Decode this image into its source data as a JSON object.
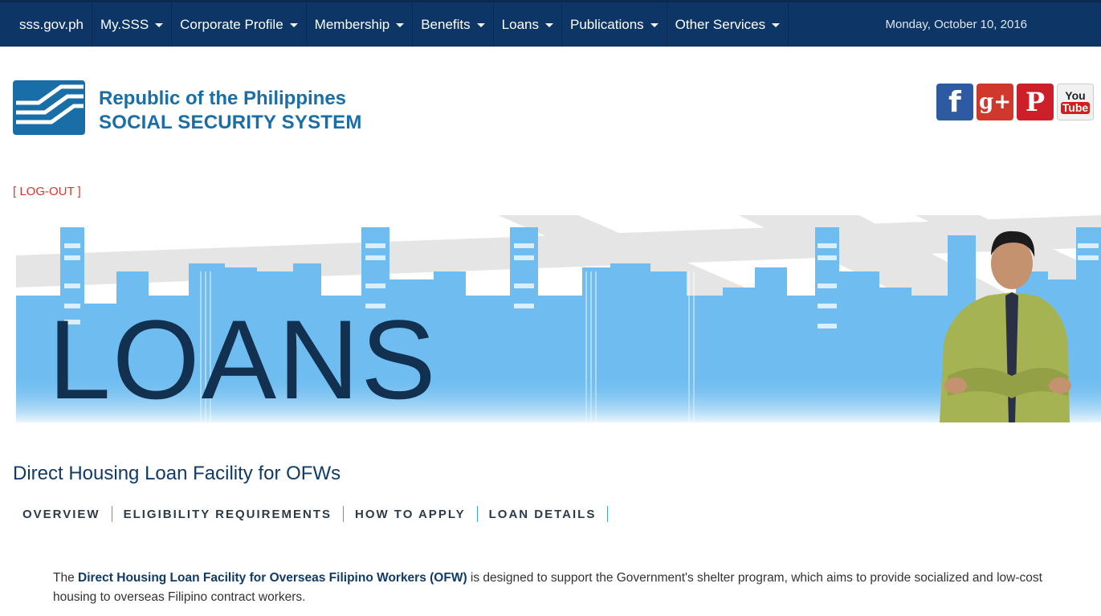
{
  "nav": {
    "home": "sss.gov.ph",
    "items": [
      {
        "label": "My.SSS"
      },
      {
        "label": "Corporate Profile"
      },
      {
        "label": "Membership"
      },
      {
        "label": "Benefits"
      },
      {
        "label": "Loans"
      },
      {
        "label": "Publications"
      },
      {
        "label": "Other Services"
      }
    ],
    "date": "Monday, October 10, 2016"
  },
  "brand": {
    "line1": "Republic of the Philippines",
    "line2": "SOCIAL SECURITY SYSTEM"
  },
  "social": {
    "facebook": "f",
    "googleplus": "g+",
    "pinterest": "P",
    "youtube_top": "You",
    "youtube_bottom": "Tube"
  },
  "logout": "[ LOG-OUT ]",
  "banner": {
    "title": "LOANS"
  },
  "page_title": "Direct Housing Loan Facility for OFWs",
  "subnav": [
    {
      "label": "OVERVIEW"
    },
    {
      "label": "ELIGIBILITY REQUIREMENTS"
    },
    {
      "label": "HOW TO APPLY"
    },
    {
      "label": "LOAN DETAILS"
    }
  ],
  "intro": {
    "prefix": "The ",
    "emphasis": "Direct Housing Loan Facility for Overseas Filipino Workers (OFW)",
    "suffix": " is designed to support the Government's shelter program, which aims to provide socialized and low-cost housing to overseas Filipino contract workers."
  },
  "colors": {
    "nav_bg": "#0d3566",
    "brand_blue": "#1a6ea8",
    "logout_red": "#e0352b",
    "skyline": "#6fbdf0",
    "separator": "#3aa6dc"
  }
}
